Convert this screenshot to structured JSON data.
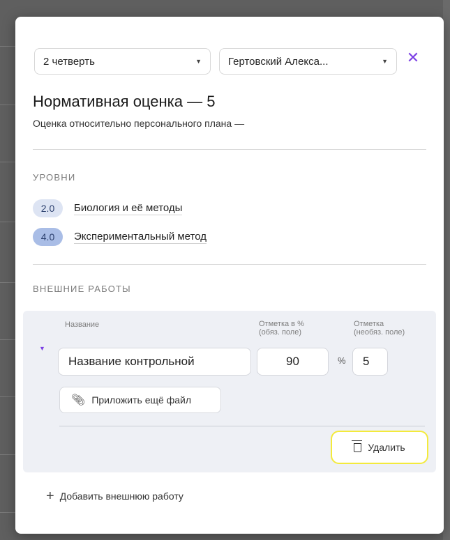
{
  "filters": {
    "quarter": "2 четверть",
    "student": "Гертовский Алекса..."
  },
  "header": {
    "title": "Нормативная оценка — 5",
    "subtitle": "Оценка относительно персонального плана —"
  },
  "levels": {
    "heading": "УРОВНИ",
    "items": [
      {
        "value": "2.0",
        "name": "Биология и её методы"
      },
      {
        "value": "4.0",
        "name": "Экспериментальный метод"
      }
    ]
  },
  "external_works": {
    "heading": "ВНЕШНИЕ РАБОТЫ",
    "columns": {
      "name": "Название",
      "percent_line1": "Отметка в %",
      "percent_line2": "(обяз. поле)",
      "mark_line1": "Отметка",
      "mark_line2": "(необяз. поле)"
    },
    "work": {
      "name": "Название контрольной",
      "percent": "90",
      "percent_sign": "%",
      "mark": "5"
    },
    "attach_label": "Приложить ещё файл",
    "delete_label": "Удалить",
    "add_label": "Добавить внешнюю работу"
  },
  "icons": {
    "close": "close-icon",
    "dropdown": "chevron-down-icon",
    "attach": "paperclip-icon",
    "delete": "trash-icon",
    "add": "plus-icon"
  },
  "colors": {
    "accent": "#7b3fe4",
    "highlight": "#f3ea3c",
    "badge_light": "#dde4f3",
    "badge_dark": "#a9bde6"
  }
}
